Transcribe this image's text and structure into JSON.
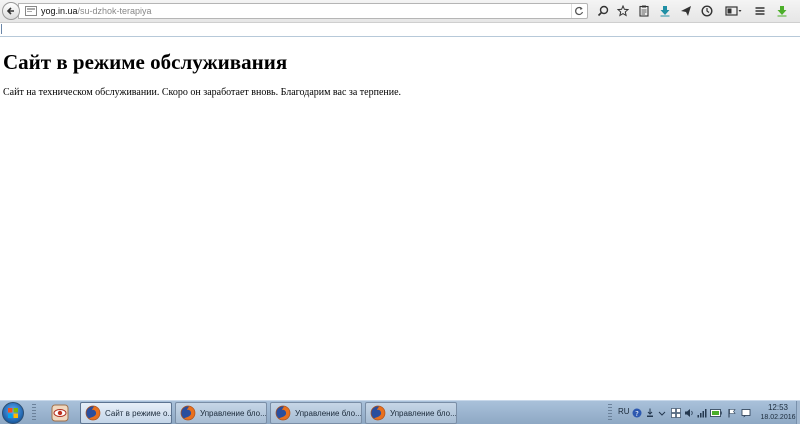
{
  "browser": {
    "url_host": "yog.in.ua",
    "url_path": "/su-dzhok-terapiya",
    "toolbar_icons": [
      "search-icon",
      "star-icon",
      "reading-list-icon",
      "download-icon",
      "send-icon",
      "history-icon",
      "screenshot-icon",
      "menu-icon",
      "green-arrow-icon"
    ]
  },
  "page": {
    "title": "Сайт в режиме обслуживания",
    "message": "Сайт на техническом обслуживании. Скоро он заработает вновь. Благодарим вас за терпение."
  },
  "taskbar": {
    "tasks": [
      {
        "label": "Сайт в режиме о...",
        "active": true
      },
      {
        "label": "Управление бло...",
        "active": false
      },
      {
        "label": "Управление бло...",
        "active": false
      },
      {
        "label": "Управление бло...",
        "active": false
      }
    ],
    "language": "RU",
    "clock_time": "12:53",
    "clock_date": "18.02.2016"
  },
  "colors": {
    "taskbar": "#9bb3cd",
    "download_arrow": "#1f8fa5",
    "green_arrow": "#4caf2a"
  }
}
